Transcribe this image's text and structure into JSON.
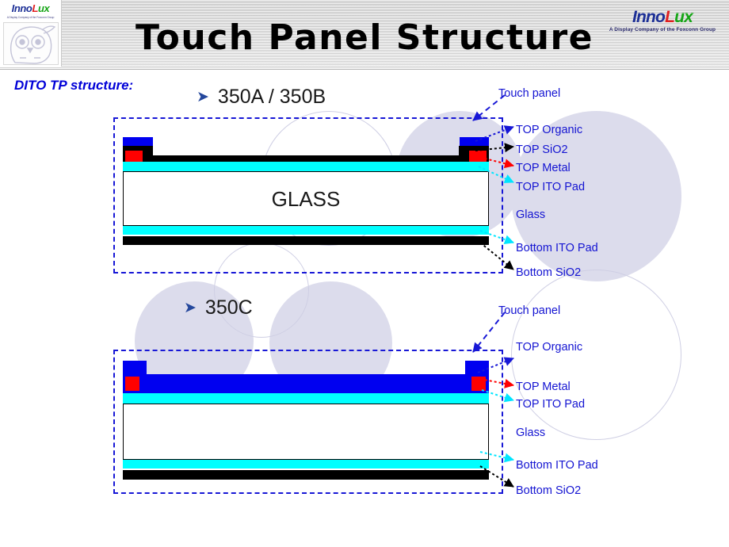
{
  "header": {
    "title": "Touch Panel Structure",
    "logo_left": {
      "wordmark_parts": [
        "Inno",
        "L",
        "ux"
      ],
      "tagline": "A Display Company of the Foxconn Group",
      "mascot_icon": "owl-mascot-icon"
    },
    "logo_right": {
      "wordmark_parts": [
        "Inno",
        "L",
        "ux"
      ],
      "tagline": "A Display Company of the Foxconn Group"
    }
  },
  "section": {
    "caption": "DITO TP structure:"
  },
  "bullets": [
    {
      "marker": "➤",
      "text": "350A / 350B"
    },
    {
      "marker": "➤",
      "text": "350C"
    }
  ],
  "diagrams": [
    {
      "id": "350ab",
      "glass_text": "GLASS",
      "callouts": [
        {
          "name": "touch-panel",
          "text": "Touch panel",
          "color": "#1414d2"
        },
        {
          "name": "top-organic",
          "text": "TOP Organic",
          "color": "#1414d2"
        },
        {
          "name": "top-sio2",
          "text": "TOP SiO2",
          "color": "#1414d2"
        },
        {
          "name": "top-metal",
          "text": "TOP Metal",
          "color": "#1414d2"
        },
        {
          "name": "top-ito-pad",
          "text": "TOP ITO Pad",
          "color": "#1414d2"
        },
        {
          "name": "glass",
          "text": "Glass",
          "color": "#1414d2"
        },
        {
          "name": "bottom-ito-pad",
          "text": "Bottom  ITO Pad",
          "color": "#1414d2"
        },
        {
          "name": "bottom-sio2",
          "text": "Bottom  SiO2",
          "color": "#1414d2"
        }
      ]
    },
    {
      "id": "350c",
      "glass_text": "",
      "callouts": [
        {
          "name": "touch-panel",
          "text": "Touch panel",
          "color": "#1414d2"
        },
        {
          "name": "top-organic",
          "text": "TOP Organic",
          "color": "#1414d2"
        },
        {
          "name": "top-metal",
          "text": "TOP Metal",
          "color": "#1414d2"
        },
        {
          "name": "top-ito-pad",
          "text": "TOP ITO Pad",
          "color": "#1414d2"
        },
        {
          "name": "glass",
          "text": "Glass",
          "color": "#1414d2"
        },
        {
          "name": "bottom-ito-pad",
          "text": "Bottom  ITO Pad",
          "color": "#1414d2"
        },
        {
          "name": "bottom-sio2",
          "text": "Bottom  SiO2",
          "color": "#1414d2"
        }
      ]
    }
  ],
  "colors": {
    "organic_blue": "#0000f0",
    "sio2_black": "#000000",
    "metal_red": "#ff0000",
    "ito_cyan": "#00ffff",
    "callout_blue": "#1414d2",
    "dashed_box": "#1717d6",
    "caption_blue": "#0000d8",
    "decor_circle": "#dcdcec"
  }
}
